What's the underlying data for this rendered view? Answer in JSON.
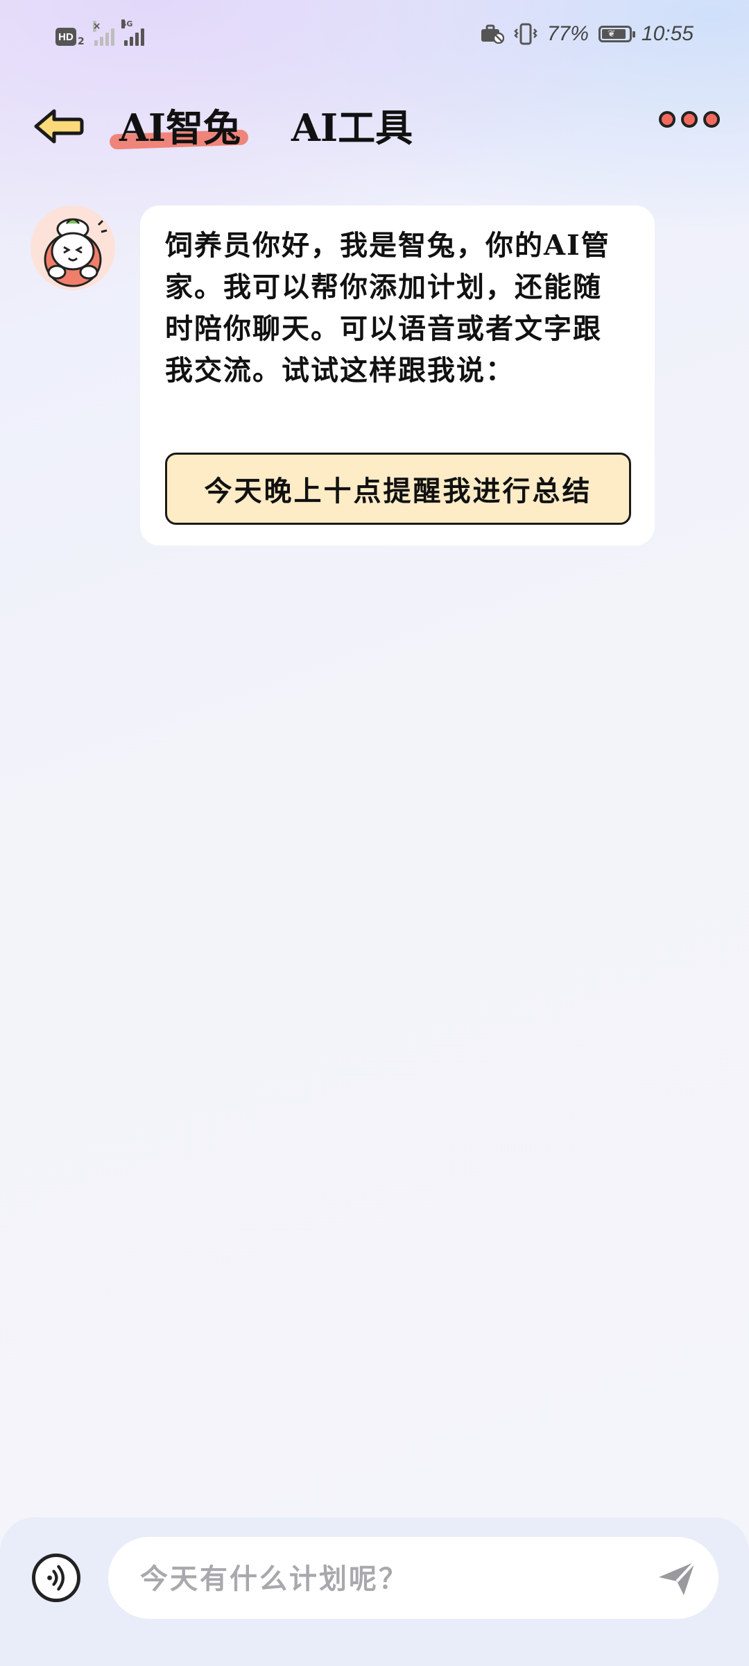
{
  "status_bar": {
    "hd_label": "HD",
    "hd_sub": "2",
    "network_type": "4G",
    "battery_percent": "77%",
    "time": "10:55",
    "icons": [
      "hd-icon",
      "signal-icon",
      "signal-4g-icon",
      "work-profile-icon",
      "vibrate-icon",
      "battery-icon"
    ]
  },
  "header": {
    "back_icon": "arrow-left-icon",
    "tabs": [
      {
        "label": "AI智兔",
        "active": true
      },
      {
        "label": "AI工具",
        "active": false
      }
    ],
    "more_icon": "more-dots-icon"
  },
  "chat": {
    "assistant_avatar": "rabbit-avatar-icon",
    "messages": [
      {
        "role": "assistant",
        "text": "饲养员你好，我是智兔，你的AI管家。我可以帮你添加计划，还能随时陪你聊天。可以语音或者文字跟我交流。试试这样跟我说：",
        "suggestion": "今天晚上十点提醒我进行总结"
      }
    ]
  },
  "input_bar": {
    "voice_icon": "voice-icon",
    "placeholder": "今天有什么计划呢？",
    "send_icon": "send-icon"
  },
  "colors": {
    "accent_coral": "#f07a6b",
    "suggestion_bg": "#fdecc6",
    "back_arrow_fill": "#fcd97a"
  }
}
